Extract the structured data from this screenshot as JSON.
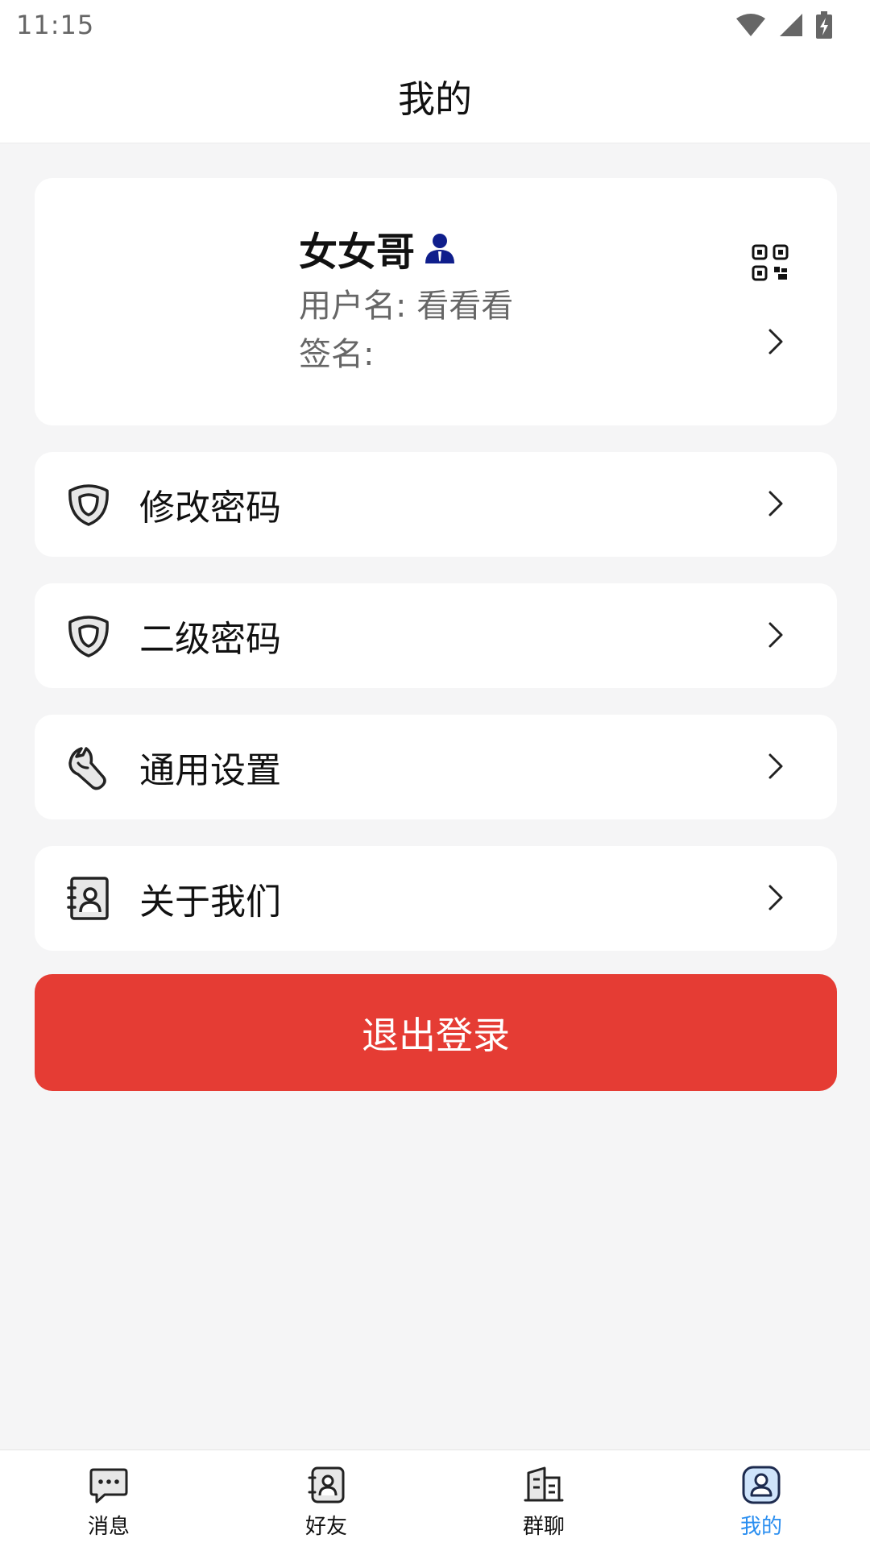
{
  "status_bar": {
    "time": "11:15"
  },
  "header": {
    "title": "我的"
  },
  "profile": {
    "name": "女女哥",
    "username": "用户名: 看看看",
    "signature": "签名:"
  },
  "menu": [
    {
      "label": "修改密码",
      "icon": "shield-icon"
    },
    {
      "label": "二级密码",
      "icon": "shield-icon"
    },
    {
      "label": "通用设置",
      "icon": "wrench-icon"
    },
    {
      "label": "关于我们",
      "icon": "contact-card-icon"
    }
  ],
  "logout": {
    "label": "退出登录"
  },
  "bottom_nav": [
    {
      "label": "消息",
      "icon": "message-icon"
    },
    {
      "label": "好友",
      "icon": "friends-icon"
    },
    {
      "label": "群聊",
      "icon": "group-chat-icon"
    },
    {
      "label": "我的",
      "icon": "profile-icon",
      "active": true
    }
  ],
  "colors": {
    "accent": "#2a8ef0",
    "logout_red": "#e53c34",
    "background": "#f5f5f6",
    "verified_badge": "#0f1e8c"
  }
}
